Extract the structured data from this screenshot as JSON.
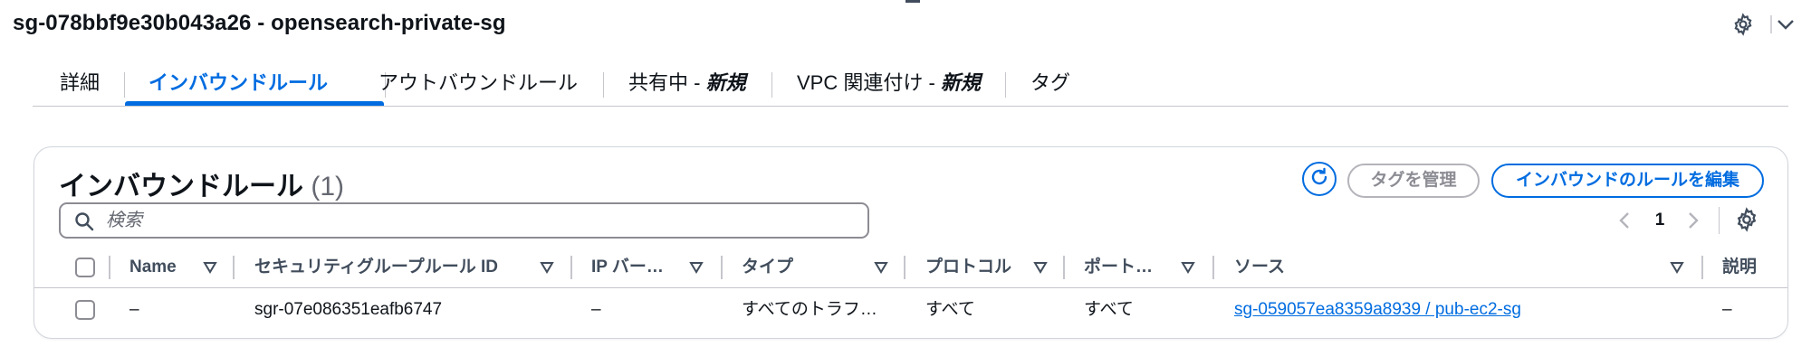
{
  "header": {
    "title": "sg-078bbf9e30b043a26 - opensearch-private-sg",
    "settings_icon": "gear-icon",
    "collapse_icon": "chevron-down-icon"
  },
  "tabs": [
    {
      "label": "詳細",
      "new": ""
    },
    {
      "label": "インバウンドルール",
      "new": "",
      "active": true
    },
    {
      "label": "アウトバウンドルール",
      "new": ""
    },
    {
      "label": "共有中 - ",
      "new": "新規"
    },
    {
      "label": "VPC 関連付け - ",
      "new": "新規"
    },
    {
      "label": "タグ",
      "new": ""
    }
  ],
  "panel": {
    "title": "インバウンドルール",
    "count": "(1)",
    "refresh_icon": "refresh-icon",
    "manage_tags_label": "タグを管理",
    "edit_rules_label": "インバウンドのルールを編集",
    "search_placeholder": "検索",
    "page_number": "1"
  },
  "table": {
    "columns": [
      "Name",
      "セキュリティグループルール ID",
      "IP バー…",
      "タイプ",
      "プロトコル",
      "ポート…",
      "ソース",
      "説明"
    ],
    "rows": [
      {
        "name": "–",
        "rule_id": "sgr-07e086351eafb6747",
        "ip_version": "–",
        "type": "すべてのトラフ…",
        "protocol": "すべて",
        "port": "すべて",
        "source": "sg-059057ea8359a8939 / pub-ec2-sg",
        "description": "–"
      }
    ]
  },
  "colors": {
    "accent": "#006ce0",
    "text": "#0f141a",
    "muted": "#656871",
    "border": "#c6c6cd"
  }
}
